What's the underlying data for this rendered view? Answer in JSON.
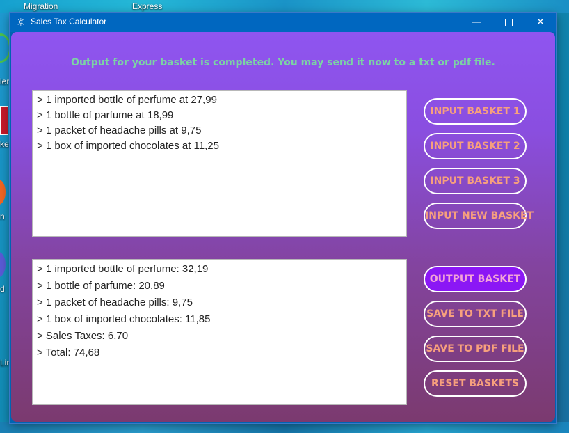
{
  "desktop": {
    "labels": [
      "Migration",
      "Express"
    ],
    "side_labels": [
      "ler",
      "ker",
      "n",
      "d",
      "Lini"
    ]
  },
  "window": {
    "title": "Sales Tax Calculator",
    "controls": {
      "minimize": "—",
      "maximize": "",
      "close": "✕"
    }
  },
  "banner": "Output for your basket is completed. You may send it now to a txt or pdf file.",
  "input_lines": [
    "> 1 imported bottle of perfume at 27,99",
    "> 1 bottle of parfume at 18,99",
    "> 1 packet of headache pills at 9,75",
    "> 1 box of imported chocolates at 11,25"
  ],
  "output_lines": [
    "> 1 imported bottle of perfume: 32,19",
    "> 1 bottle of parfume: 20,89",
    "> 1 packet of headache pills: 9,75",
    "> 1 box of imported chocolates: 11,85",
    "> Sales Taxes: 6,70",
    "> Total: 74,68"
  ],
  "buttons": {
    "input_basket_1": "INPUT BASKET 1",
    "input_basket_2": "INPUT BASKET 2",
    "input_basket_3": "INPUT BASKET 3",
    "input_new_basket": "INPUT NEW BASKET",
    "output_basket": "OUTPUT BASKET",
    "save_txt": "SAVE TO TXT FILE",
    "save_pdf": "SAVE TO PDF FILE",
    "reset": "RESET BASKETS"
  },
  "colors": {
    "banner": "#7cd3a4",
    "button_text": "#f7a07d",
    "active_button": "#8b17f5",
    "titlebar": "#0067c0"
  }
}
